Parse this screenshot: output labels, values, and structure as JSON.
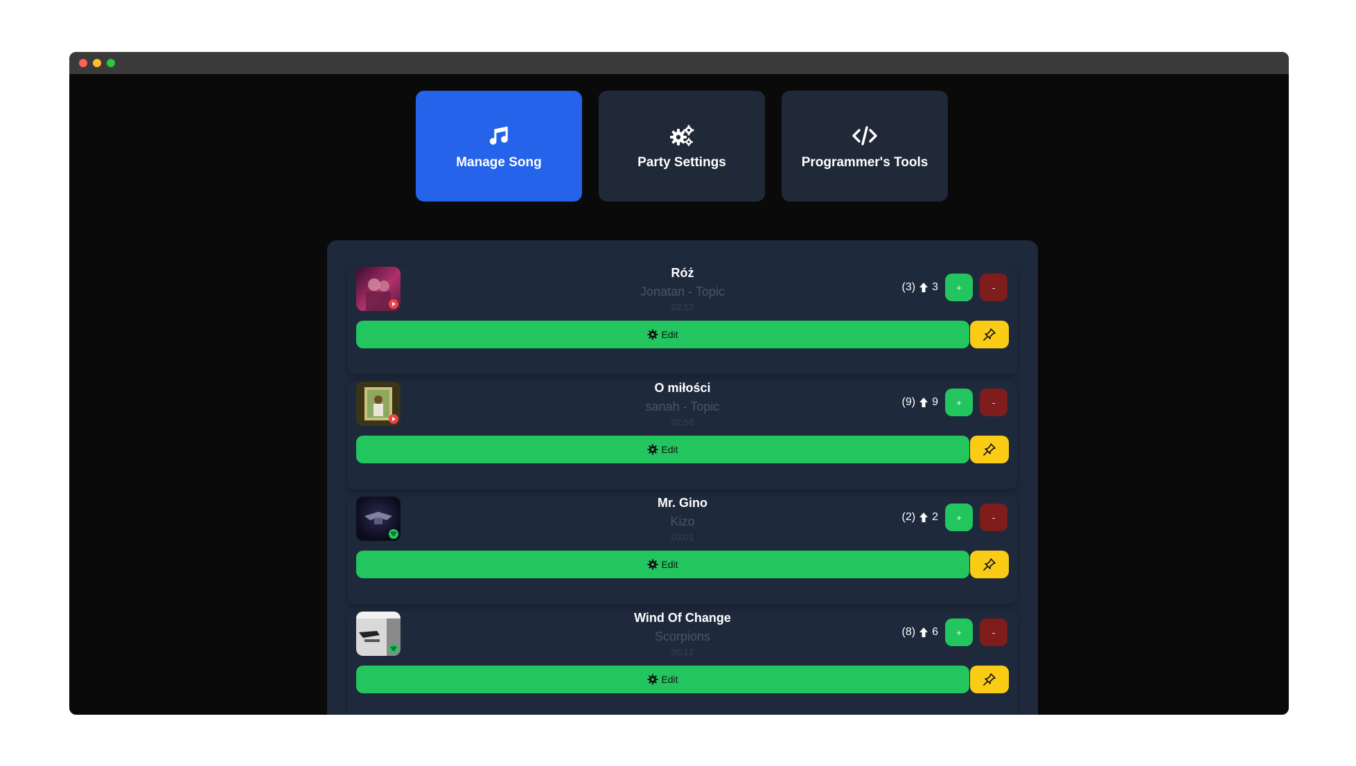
{
  "window": {
    "controls": [
      "close",
      "minimize",
      "maximize"
    ]
  },
  "tabs": [
    {
      "label": "Manage Song",
      "icon": "music-note-icon",
      "active": true
    },
    {
      "label": "Party Settings",
      "icon": "gears-icon",
      "active": false
    },
    {
      "label": "Programmer's Tools",
      "icon": "code-icon",
      "active": false
    }
  ],
  "songs": [
    {
      "title": "Róż",
      "artist": "Jonatan - Topic",
      "duration": "02:52",
      "votes_total": "(3)",
      "votes_up": "3",
      "source": "youtube",
      "plus_label": "+",
      "minus_label": "-",
      "edit_label": "Edit"
    },
    {
      "title": "O miłości",
      "artist": "sanah - Topic",
      "duration": "02:58",
      "votes_total": "(9)",
      "votes_up": "9",
      "source": "youtube",
      "plus_label": "+",
      "minus_label": "-",
      "edit_label": "Edit"
    },
    {
      "title": "Mr. Gino",
      "artist": "Kizo",
      "duration": "03:01",
      "votes_total": "(2)",
      "votes_up": "2",
      "source": "spotify",
      "plus_label": "+",
      "minus_label": "-",
      "edit_label": "Edit"
    },
    {
      "title": "Wind Of Change",
      "artist": "Scorpions",
      "duration": "05:12",
      "votes_total": "(8)",
      "votes_up": "6",
      "source": "spotify",
      "plus_label": "+",
      "minus_label": "-",
      "edit_label": "Edit"
    }
  ],
  "colors": {
    "accent": "#2563eb",
    "panel": "#1e293b",
    "success": "#22c55e",
    "danger": "#7f1d1d",
    "pin": "#facc15"
  }
}
